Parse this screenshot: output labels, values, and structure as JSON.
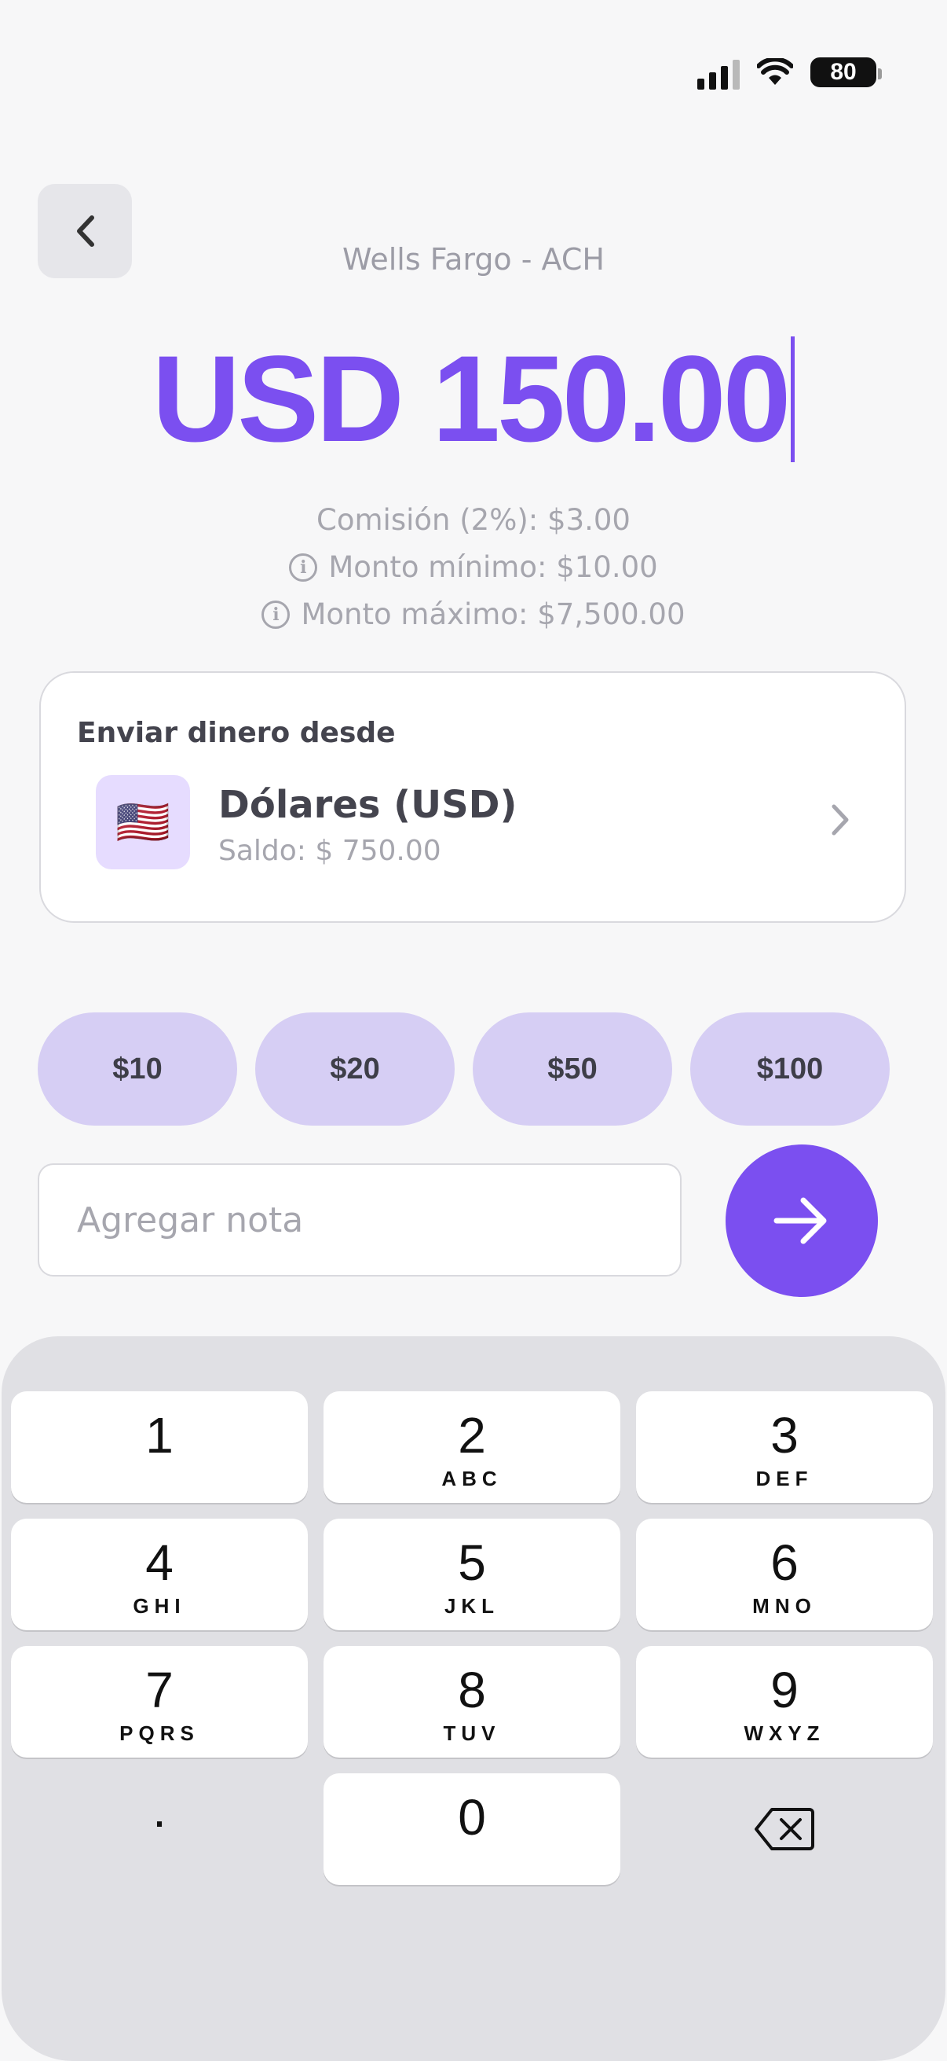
{
  "status_bar": {
    "battery": "80"
  },
  "header": {
    "subtitle": "Wells Fargo - ACH"
  },
  "amount": {
    "value": "USD 150.00"
  },
  "fees": {
    "commission": "Comisión (2%): $3.00",
    "min": "Monto mínimo: $10.00",
    "max": "Monto máximo: $7,500.00"
  },
  "source": {
    "title": "Enviar dinero desde",
    "flag": "🇺🇸",
    "currency": "Dólares (USD)",
    "balance": "Saldo: $ 750.00"
  },
  "quick_amounts": [
    "$10",
    "$20",
    "$50",
    "$100"
  ],
  "note": {
    "placeholder": "Agregar nota"
  },
  "keypad": {
    "keys": [
      {
        "num": "1",
        "letters": ""
      },
      {
        "num": "2",
        "letters": "ABC"
      },
      {
        "num": "3",
        "letters": "DEF"
      },
      {
        "num": "4",
        "letters": "GHI"
      },
      {
        "num": "5",
        "letters": "JKL"
      },
      {
        "num": "6",
        "letters": "MNO"
      },
      {
        "num": "7",
        "letters": "PQRS"
      },
      {
        "num": "8",
        "letters": "TUV"
      },
      {
        "num": "9",
        "letters": "WXYZ"
      },
      {
        "num": ".",
        "letters": ""
      },
      {
        "num": "0",
        "letters": ""
      }
    ]
  },
  "colors": {
    "accent": "#7b4ff0",
    "chip": "#d6cef4",
    "keypad_bg": "#e0e0e4"
  },
  "icons": [
    "back-icon",
    "info-icon",
    "chevron-right-icon",
    "arrow-right-icon",
    "backspace-icon",
    "signal-icon",
    "wifi-icon",
    "battery-icon"
  ]
}
